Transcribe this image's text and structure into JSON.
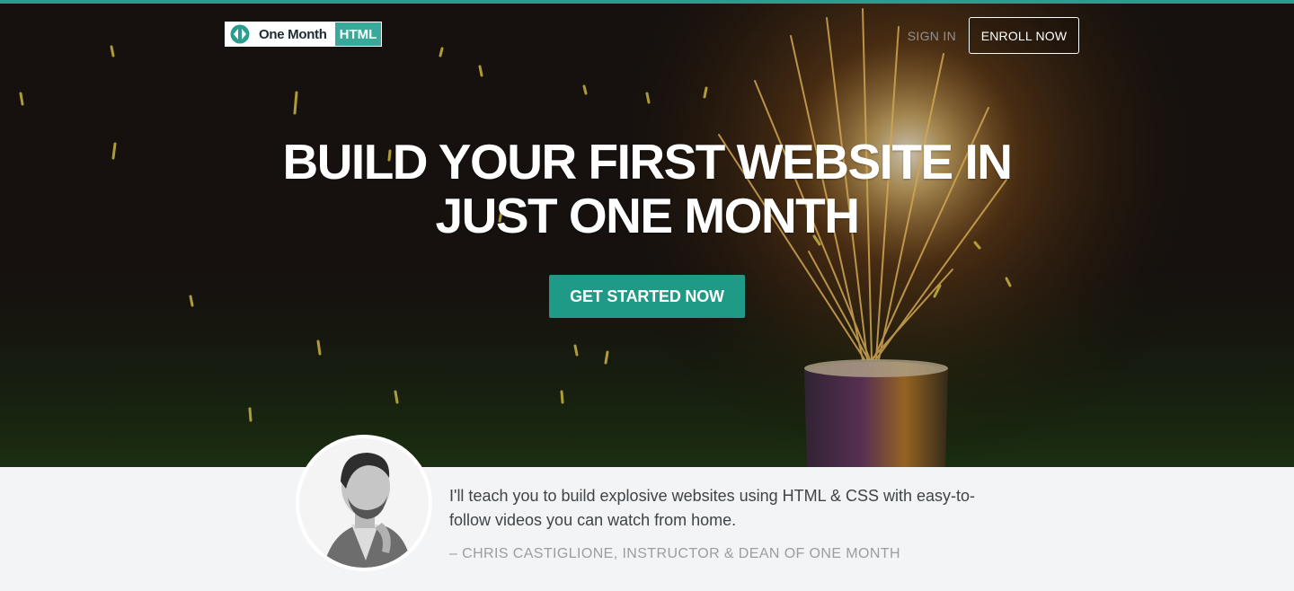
{
  "brand": {
    "name": "One Month",
    "badge": "HTML",
    "accent": "#38a99a"
  },
  "nav": {
    "signin_label": "SIGN IN",
    "enroll_label": "ENROLL NOW"
  },
  "hero": {
    "headline_line1": "BUILD YOUR FIRST WEBSITE IN",
    "headline_line2": "JUST ONE MONTH",
    "cta_label": "GET STARTED NOW",
    "cta_color": "#1f9a86",
    "background_image": "firework-sparkler-photo"
  },
  "testimonial": {
    "quote_line1": "I'll teach you to build explosive websites using HTML & CSS with easy-to-",
    "quote_line2": "follow videos you can watch from home.",
    "attribution": "– CHRIS CASTIGLIONE, INSTRUCTOR & DEAN OF ONE MONTH",
    "avatar": "instructor-portrait"
  }
}
